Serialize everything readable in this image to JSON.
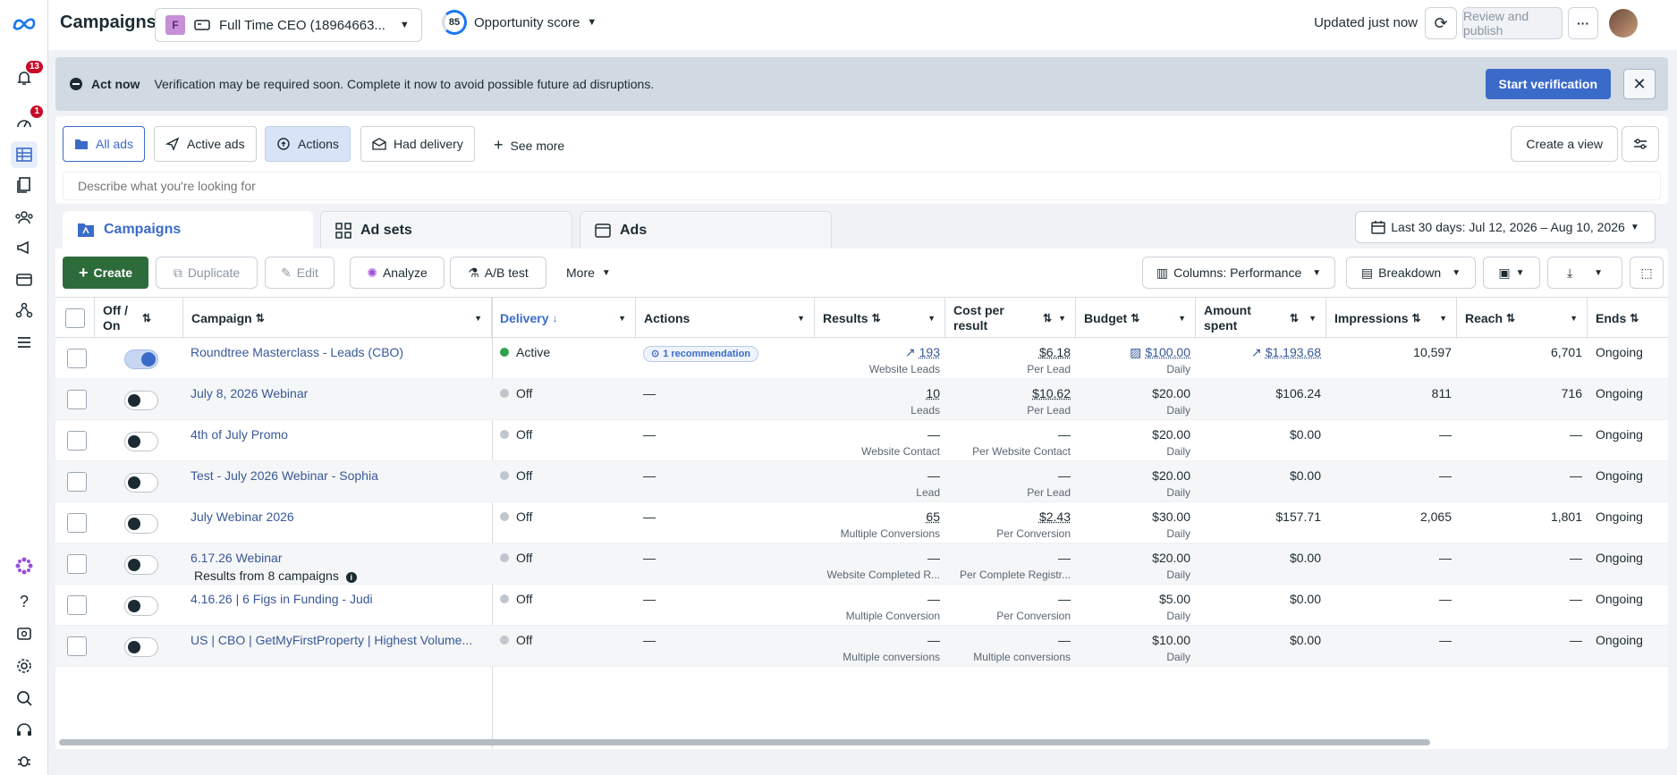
{
  "header": {
    "title": "Campaigns",
    "account_initial": "F",
    "account_name": "Full Time CEO (18964663...",
    "score_value": "85",
    "score_label": "Opportunity score",
    "updated": "Updated just now",
    "review_label": "Review and publish"
  },
  "rail": {
    "notifications_count": "13",
    "alerts_count": "1"
  },
  "alert": {
    "heading": "Act now",
    "message": "Verification may be required soon. Complete it now to avoid possible future ad disruptions.",
    "button": "Start verification"
  },
  "filters": {
    "chips": [
      "All ads",
      "Active ads",
      "Actions",
      "Had delivery"
    ],
    "see_more": "See more",
    "create_view": "Create a view",
    "search_placeholder": "Describe what you're looking for"
  },
  "tabs": {
    "campaigns": "Campaigns",
    "adsets": "Ad sets",
    "ads": "Ads"
  },
  "date_range": "Last 30 days: Jul 12, 2026 – Aug 10, 2026",
  "toolbar": {
    "create": "Create",
    "duplicate": "Duplicate",
    "edit": "Edit",
    "analyze": "Analyze",
    "ab_test": "A/B test",
    "more": "More",
    "columns": "Columns: Performance",
    "breakdown": "Breakdown"
  },
  "columns": {
    "offon": "Off / On",
    "campaign": "Campaign",
    "delivery": "Delivery",
    "actions": "Actions",
    "results": "Results",
    "cpr": "Cost per result",
    "budget": "Budget",
    "spent": "Amount spent",
    "impressions": "Impressions",
    "reach": "Reach",
    "ends": "Ends"
  },
  "rows": [
    {
      "name": "Roundtree Masterclass - Leads (CBO)",
      "delivery": "Active",
      "actions": "1 recommendation",
      "results": "193",
      "results_sub": "Website Leads",
      "cpr": "$6.18",
      "cpr_sub": "Per Lead",
      "budget": "$100.00",
      "budget_sub": "Daily",
      "spent": "$1,193.68",
      "impressions": "10,597",
      "reach": "6,701",
      "ends": "Ongoing"
    },
    {
      "name": "July 8, 2026 Webinar",
      "delivery": "Off",
      "actions": "—",
      "results": "10",
      "results_sub": "Leads",
      "cpr": "$10.62",
      "cpr_sub": "Per Lead",
      "budget": "$20.00",
      "budget_sub": "Daily",
      "spent": "$106.24",
      "impressions": "811",
      "reach": "716",
      "ends": "Ongoing"
    },
    {
      "name": "4th of July Promo",
      "delivery": "Off",
      "actions": "—",
      "results": "—",
      "results_sub": "Website Contact",
      "cpr": "—",
      "cpr_sub": "Per Website Contact",
      "budget": "$20.00",
      "budget_sub": "Daily",
      "spent": "$0.00",
      "impressions": "—",
      "reach": "—",
      "ends": "Ongoing"
    },
    {
      "name": "Test - July 2026 Webinar - Sophia",
      "delivery": "Off",
      "actions": "—",
      "results": "—",
      "results_sub": "Lead",
      "cpr": "—",
      "cpr_sub": "Per Lead",
      "budget": "$20.00",
      "budget_sub": "Daily",
      "spent": "$0.00",
      "impressions": "—",
      "reach": "—",
      "ends": "Ongoing"
    },
    {
      "name": "July Webinar 2026",
      "delivery": "Off",
      "actions": "—",
      "results": "65",
      "results_sub": "Multiple Conversions",
      "cpr": "$2.43",
      "cpr_sub": "Per Conversion",
      "budget": "$30.00",
      "budget_sub": "Daily",
      "spent": "$157.71",
      "impressions": "2,065",
      "reach": "1,801",
      "ends": "Ongoing"
    },
    {
      "name": "6.17.26 Webinar",
      "delivery": "Off",
      "actions": "—",
      "results": "—",
      "results_sub": "Website Completed R...",
      "cpr": "—",
      "cpr_sub": "Per Complete Registr...",
      "budget": "$20.00",
      "budget_sub": "Daily",
      "spent": "$0.00",
      "impressions": "—",
      "reach": "—",
      "ends": "Ongoing"
    },
    {
      "name": "4.16.26 | 6 Figs in Funding - Judi",
      "delivery": "Off",
      "actions": "—",
      "results": "—",
      "results_sub": "Multiple Conversion",
      "cpr": "—",
      "cpr_sub": "Per Conversion",
      "budget": "$5.00",
      "budget_sub": "Daily",
      "spent": "$0.00",
      "impressions": "—",
      "reach": "—",
      "ends": "Ongoing"
    },
    {
      "name": "US | CBO | GetMyFirstProperty | Highest Volume...",
      "delivery": "Off",
      "actions": "—",
      "results": "—",
      "results_sub": "Multiple conversions",
      "cpr": "—",
      "cpr_sub": "Multiple conversions",
      "budget": "$10.00",
      "budget_sub": "Daily",
      "spent": "$0.00",
      "impressions": "—",
      "reach": "—",
      "ends": "Ongoing"
    }
  ],
  "footer": "Results from 8 campaigns"
}
